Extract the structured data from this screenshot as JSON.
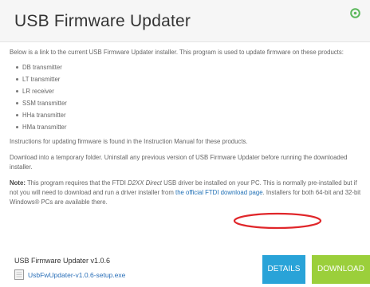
{
  "header": {
    "title": "USB Firmware Updater"
  },
  "content": {
    "intro": "Below is a link to the current USB Firmware Updater installer. This program is used to update firmware on these products:",
    "products": [
      "DB transmitter",
      "LT transmitter",
      "LR receiver",
      "SSM transmitter",
      "HHa transmitter",
      "HMa transmitter"
    ],
    "instructions": "Instructions for updating firmware is found in the Instruction Manual for these products.",
    "download_hint": "Download into a temporary folder. Uninstall any previous version of USB Firmware Updater before running the downloaded installer.",
    "note": {
      "label": "Note:",
      "text_before": " This program requires that the FTDI ",
      "driver_name": "D2XX Direct",
      "text_middle": " USB driver be installed on your PC. This is normally pre-installed but if not you will need to download and run a driver installer from ",
      "link_text": "the official FTDI download page",
      "text_after": ". Installers for both 64-bit and 32-bit Windows® PCs are available there."
    }
  },
  "download": {
    "product_name": "USB Firmware Updater v1.0.6",
    "file_name": "UsbFwUpdater-v1.0.6-setup.exe",
    "details_label": "DETAILS",
    "download_label": "DOWNLOAD"
  },
  "colors": {
    "details_button": "#29a3d8",
    "download_button": "#9bcf3b",
    "link": "#1f6fb5",
    "circle_annotation": "#e0262a",
    "toggle_icon": "#5cb85c"
  },
  "icons": {
    "toggle": "circle-up-icon",
    "file": "file-icon"
  }
}
